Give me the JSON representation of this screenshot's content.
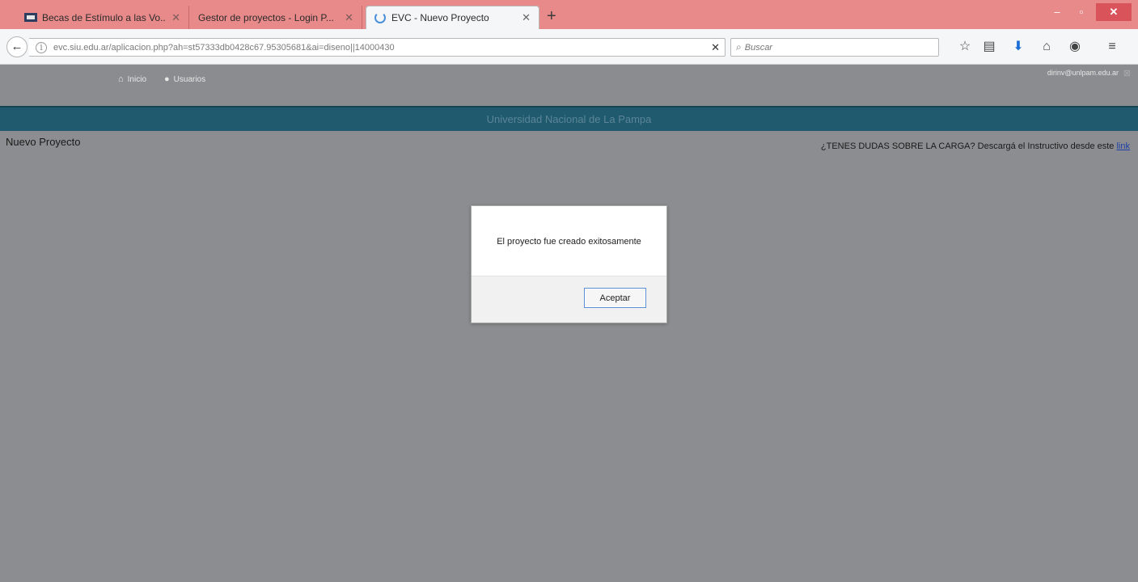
{
  "browser": {
    "tabs": [
      {
        "label": "Becas de Estímulo a las Vo..."
      },
      {
        "label": "Gestor de proyectos - Login P..."
      },
      {
        "label": "EVC - Nuevo Proyecto"
      }
    ],
    "url": "evc.siu.edu.ar/aplicacion.php?ah=st57333db0428c67.95305681&ai=diseno||14000430",
    "search_placeholder": "Buscar",
    "toolbar_icons": [
      "star-icon",
      "reading-list-icon",
      "download-icon",
      "home-icon",
      "pocket-icon",
      "menu-icon"
    ]
  },
  "app": {
    "nav": {
      "home_label": "Inicio",
      "users_label": "Usuarios"
    },
    "user_email": "dirinv@unlpam.edu.ar",
    "university": "Universidad Nacional de La Pampa",
    "page_title": "Nuevo Proyecto",
    "help_text": "¿TENES DUDAS SOBRE LA CARGA? Descargá el Instructivo desde este",
    "help_link": "link"
  },
  "dialog": {
    "message": "El proyecto fue creado exitosamente",
    "ok_label": "Aceptar"
  },
  "colors": {
    "tabstrip": "#e8898a",
    "univ_bar": "#1f5a6e",
    "overlay": "#8c8d90"
  }
}
